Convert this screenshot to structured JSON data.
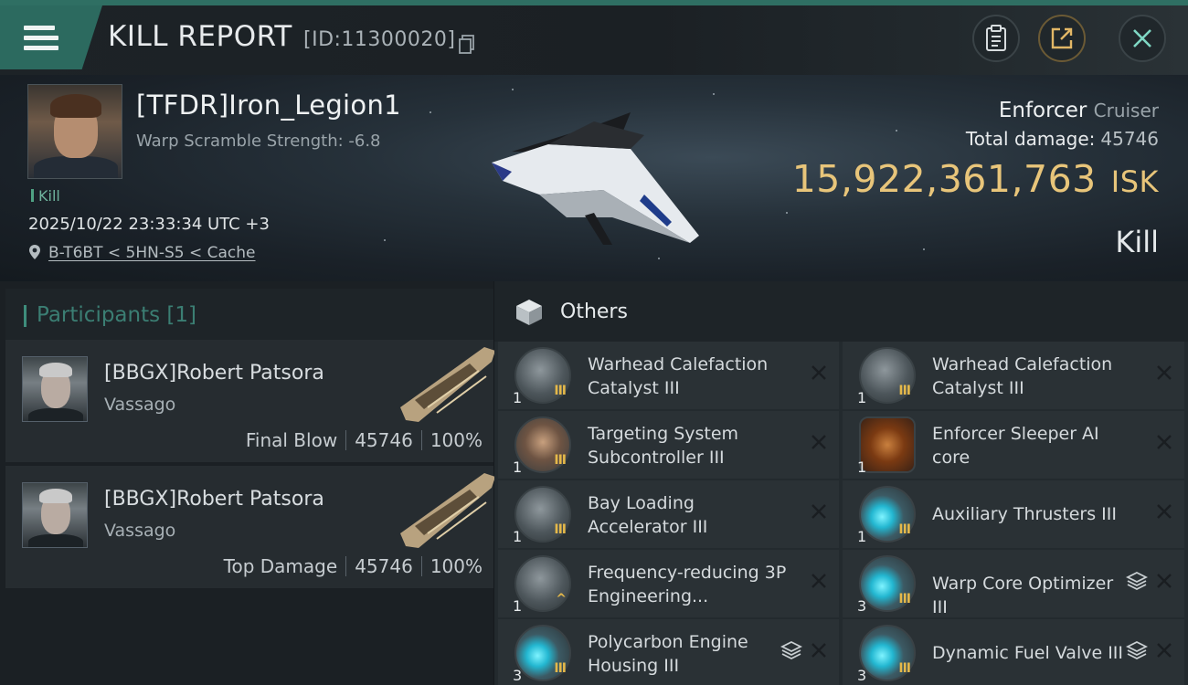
{
  "header": {
    "title": "KILL REPORT",
    "report_id": "[ID:11300020]"
  },
  "victim": {
    "name": "[TFDR]Iron_Legion1",
    "warp_scramble": "Warp Scramble Strength: -6.8",
    "tag": "Kill",
    "timestamp": "2025/10/22 23:33:34 UTC +3",
    "location": "B-T6BT < 5HN-S5 < Cache",
    "ship_name": "Enforcer",
    "ship_class": "Cruiser",
    "total_damage_label": "Total damage:",
    "total_damage": "45746",
    "isk_value": "15,922,361,763",
    "isk_unit": "ISK",
    "result": "Kill"
  },
  "participants": {
    "title": "Participants",
    "count": "[1]",
    "items": [
      {
        "name": "[BBGX]Robert Patsora",
        "ship": "Vassago",
        "role": "Final Blow",
        "damage": "45746",
        "percent": "100%"
      },
      {
        "name": "[BBGX]Robert Patsora",
        "ship": "Vassago",
        "role": "Top Damage",
        "damage": "45746",
        "percent": "100%"
      }
    ]
  },
  "others": {
    "title": "Others",
    "items": [
      {
        "name": "Warhead Calefaction Catalyst III",
        "qty": "1",
        "icon": "launcher-rig-icon",
        "rank": "III",
        "stack": false
      },
      {
        "name": "Warhead Calefaction Catalyst III",
        "qty": "1",
        "icon": "launcher-rig-icon",
        "rank": "III",
        "stack": false
      },
      {
        "name": "Targeting System Subcontroller III",
        "qty": "1",
        "icon": "subcontroller-icon",
        "rank": "III",
        "stack": false
      },
      {
        "name": "Enforcer Sleeper AI core",
        "qty": "1",
        "icon": "ai-core-icon",
        "rank": "",
        "stack": false
      },
      {
        "name": "Bay Loading Accelerator III",
        "qty": "1",
        "icon": "launcher-rig-icon",
        "rank": "III",
        "stack": false
      },
      {
        "name": "Auxiliary Thrusters III",
        "qty": "1",
        "icon": "thruster-icon",
        "rank": "III",
        "stack": false
      },
      {
        "name": "Frequency-reducing 3P Engineering...",
        "qty": "1",
        "icon": "engineering-chip-icon",
        "rank": "^",
        "stack": false
      },
      {
        "name": "Warp Core Optimizer III",
        "qty": "3",
        "icon": "thruster-icon",
        "rank": "III",
        "stack": true
      },
      {
        "name": "Polycarbon Engine Housing III",
        "qty": "3",
        "icon": "thruster-icon",
        "rank": "III",
        "stack": true
      },
      {
        "name": "Dynamic Fuel Valve III",
        "qty": "3",
        "icon": "thruster-icon",
        "rank": "III",
        "stack": true
      }
    ]
  },
  "colors": {
    "accent": "#2c6a5f",
    "isk_gold": "#e8c57a",
    "rank_gold": "#e4b84a"
  }
}
